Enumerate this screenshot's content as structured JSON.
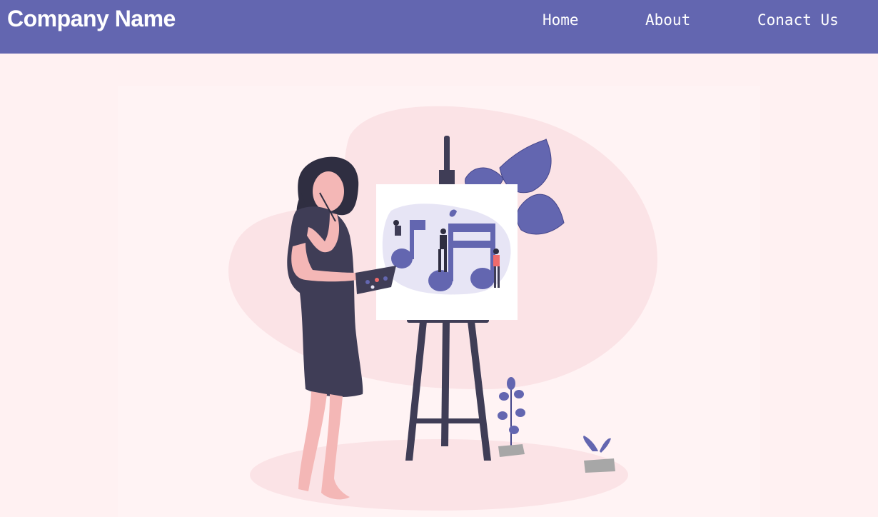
{
  "header": {
    "brand": "Company Name",
    "nav": [
      {
        "label": "Home"
      },
      {
        "label": "About"
      },
      {
        "label": "Conact Us"
      }
    ]
  },
  "colors": {
    "nav_background": "#6366b0",
    "page_background": "#fff1f2",
    "accent": "#6366b0"
  },
  "hero": {
    "image_icon": "painter-at-easel-illustration"
  }
}
